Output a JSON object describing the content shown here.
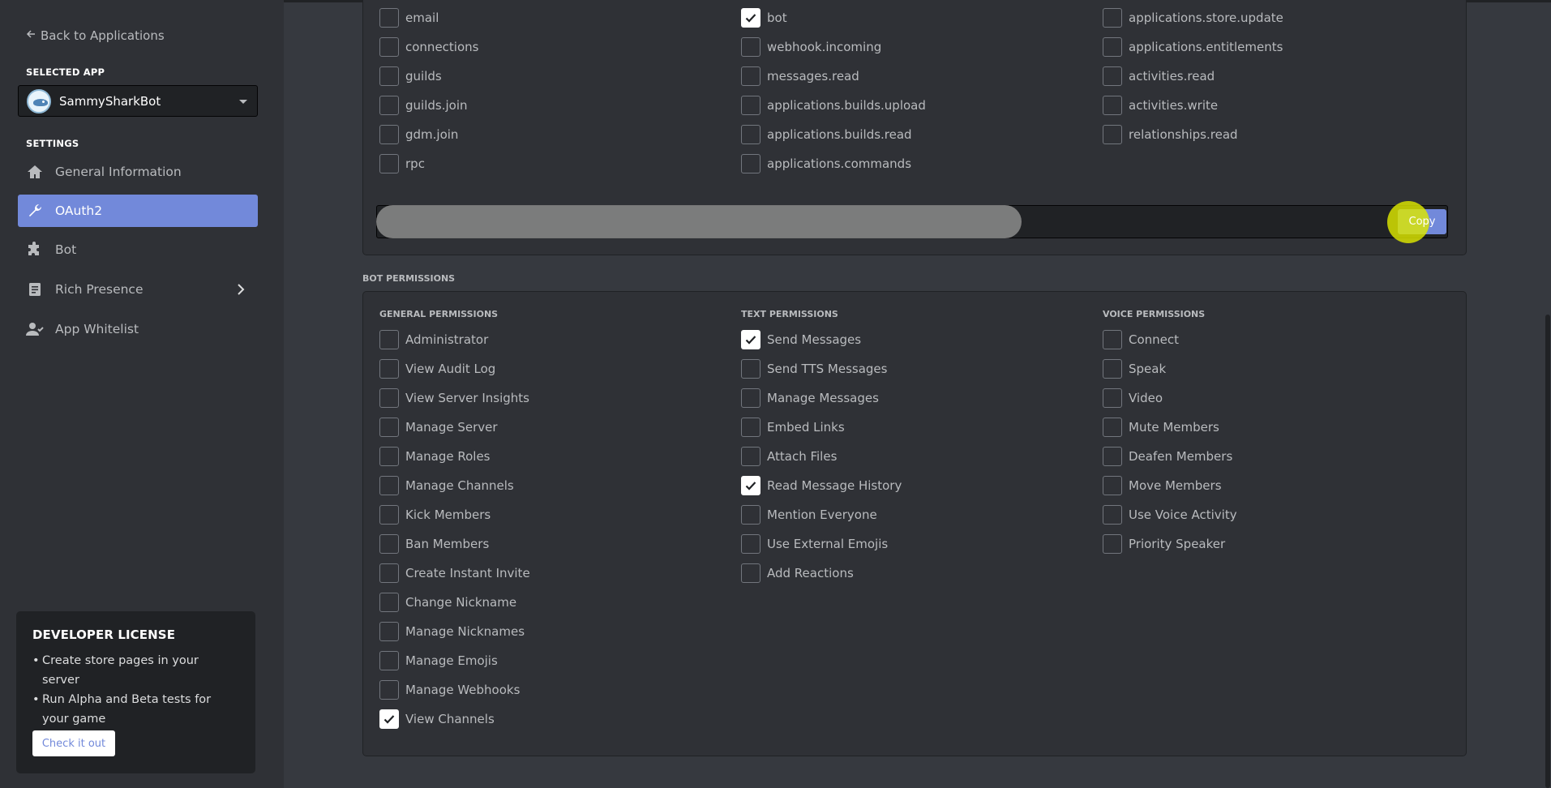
{
  "sidebar": {
    "back_label": "Back to Applications",
    "selected_app_label": "SELECTED APP",
    "app_name": "SammySharkBot",
    "settings_label": "SETTINGS",
    "nav": [
      {
        "label": "General Information",
        "icon": "home-icon",
        "active": false
      },
      {
        "label": "OAuth2",
        "icon": "wrench-icon",
        "active": true
      },
      {
        "label": "Bot",
        "icon": "puzzle-icon",
        "active": false
      },
      {
        "label": "Rich Presence",
        "icon": "document-icon",
        "active": false
      },
      {
        "label": "App Whitelist",
        "icon": "user-icon",
        "active": false
      }
    ],
    "license": {
      "title": "DEVELOPER LICENSE",
      "bullets": [
        "Create store pages in your server",
        "Run Alpha and Beta tests for your game"
      ],
      "button": "Check it out"
    }
  },
  "scopes": {
    "col1": [
      {
        "label": "email",
        "checked": false
      },
      {
        "label": "connections",
        "checked": false
      },
      {
        "label": "guilds",
        "checked": false
      },
      {
        "label": "guilds.join",
        "checked": false
      },
      {
        "label": "gdm.join",
        "checked": false
      },
      {
        "label": "rpc",
        "checked": false
      }
    ],
    "col2": [
      {
        "label": "bot",
        "checked": true
      },
      {
        "label": "webhook.incoming",
        "checked": false
      },
      {
        "label": "messages.read",
        "checked": false
      },
      {
        "label": "applications.builds.upload",
        "checked": false
      },
      {
        "label": "applications.builds.read",
        "checked": false
      },
      {
        "label": "applications.commands",
        "checked": false
      }
    ],
    "col3": [
      {
        "label": "applications.store.update",
        "checked": false
      },
      {
        "label": "applications.entitlements",
        "checked": false
      },
      {
        "label": "activities.read",
        "checked": false
      },
      {
        "label": "activities.write",
        "checked": false
      },
      {
        "label": "relationships.read",
        "checked": false
      }
    ],
    "copy_label": "Copy"
  },
  "bot_permissions": {
    "label": "BOT PERMISSIONS",
    "general": {
      "title": "GENERAL PERMISSIONS",
      "items": [
        {
          "label": "Administrator",
          "checked": false
        },
        {
          "label": "View Audit Log",
          "checked": false
        },
        {
          "label": "View Server Insights",
          "checked": false
        },
        {
          "label": "Manage Server",
          "checked": false
        },
        {
          "label": "Manage Roles",
          "checked": false
        },
        {
          "label": "Manage Channels",
          "checked": false
        },
        {
          "label": "Kick Members",
          "checked": false
        },
        {
          "label": "Ban Members",
          "checked": false
        },
        {
          "label": "Create Instant Invite",
          "checked": false
        },
        {
          "label": "Change Nickname",
          "checked": false
        },
        {
          "label": "Manage Nicknames",
          "checked": false
        },
        {
          "label": "Manage Emojis",
          "checked": false
        },
        {
          "label": "Manage Webhooks",
          "checked": false
        },
        {
          "label": "View Channels",
          "checked": true
        }
      ]
    },
    "text": {
      "title": "TEXT PERMISSIONS",
      "items": [
        {
          "label": "Send Messages",
          "checked": true
        },
        {
          "label": "Send TTS Messages",
          "checked": false
        },
        {
          "label": "Manage Messages",
          "checked": false
        },
        {
          "label": "Embed Links",
          "checked": false
        },
        {
          "label": "Attach Files",
          "checked": false
        },
        {
          "label": "Read Message History",
          "checked": true
        },
        {
          "label": "Mention Everyone",
          "checked": false
        },
        {
          "label": "Use External Emojis",
          "checked": false
        },
        {
          "label": "Add Reactions",
          "checked": false
        }
      ]
    },
    "voice": {
      "title": "VOICE PERMISSIONS",
      "items": [
        {
          "label": "Connect",
          "checked": false
        },
        {
          "label": "Speak",
          "checked": false
        },
        {
          "label": "Video",
          "checked": false
        },
        {
          "label": "Mute Members",
          "checked": false
        },
        {
          "label": "Deafen Members",
          "checked": false
        },
        {
          "label": "Move Members",
          "checked": false
        },
        {
          "label": "Use Voice Activity",
          "checked": false
        },
        {
          "label": "Priority Speaker",
          "checked": false
        }
      ]
    }
  },
  "colors": {
    "accent": "#7289da",
    "background": "#36393f",
    "sidebar": "#2f3136",
    "cursor_highlight": "#dee800"
  }
}
